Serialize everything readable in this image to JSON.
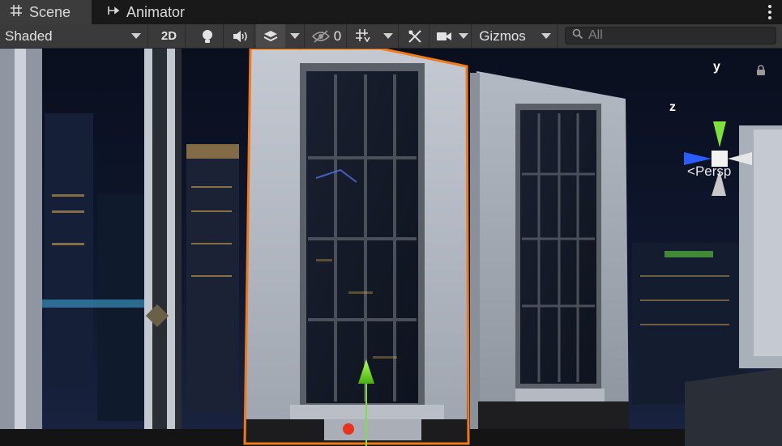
{
  "tabs": [
    {
      "label": "Scene",
      "icon": "grid-hash-icon",
      "active": true
    },
    {
      "label": "Animator",
      "icon": "animator-icon",
      "active": false
    }
  ],
  "toolbar": {
    "draw_mode": "Shaded",
    "mode_2d": "2D",
    "hidden_count": "0",
    "gizmos": "Gizmos",
    "search_placeholder": "All"
  },
  "gizmo": {
    "y_label": "y",
    "z_label": "z",
    "projection": "Persp"
  },
  "colors": {
    "selection_outline": "#f07a1a",
    "y_axis": "#7ee03a",
    "z_axis": "#2a5cff",
    "pivot_dot": "#e8321a"
  }
}
